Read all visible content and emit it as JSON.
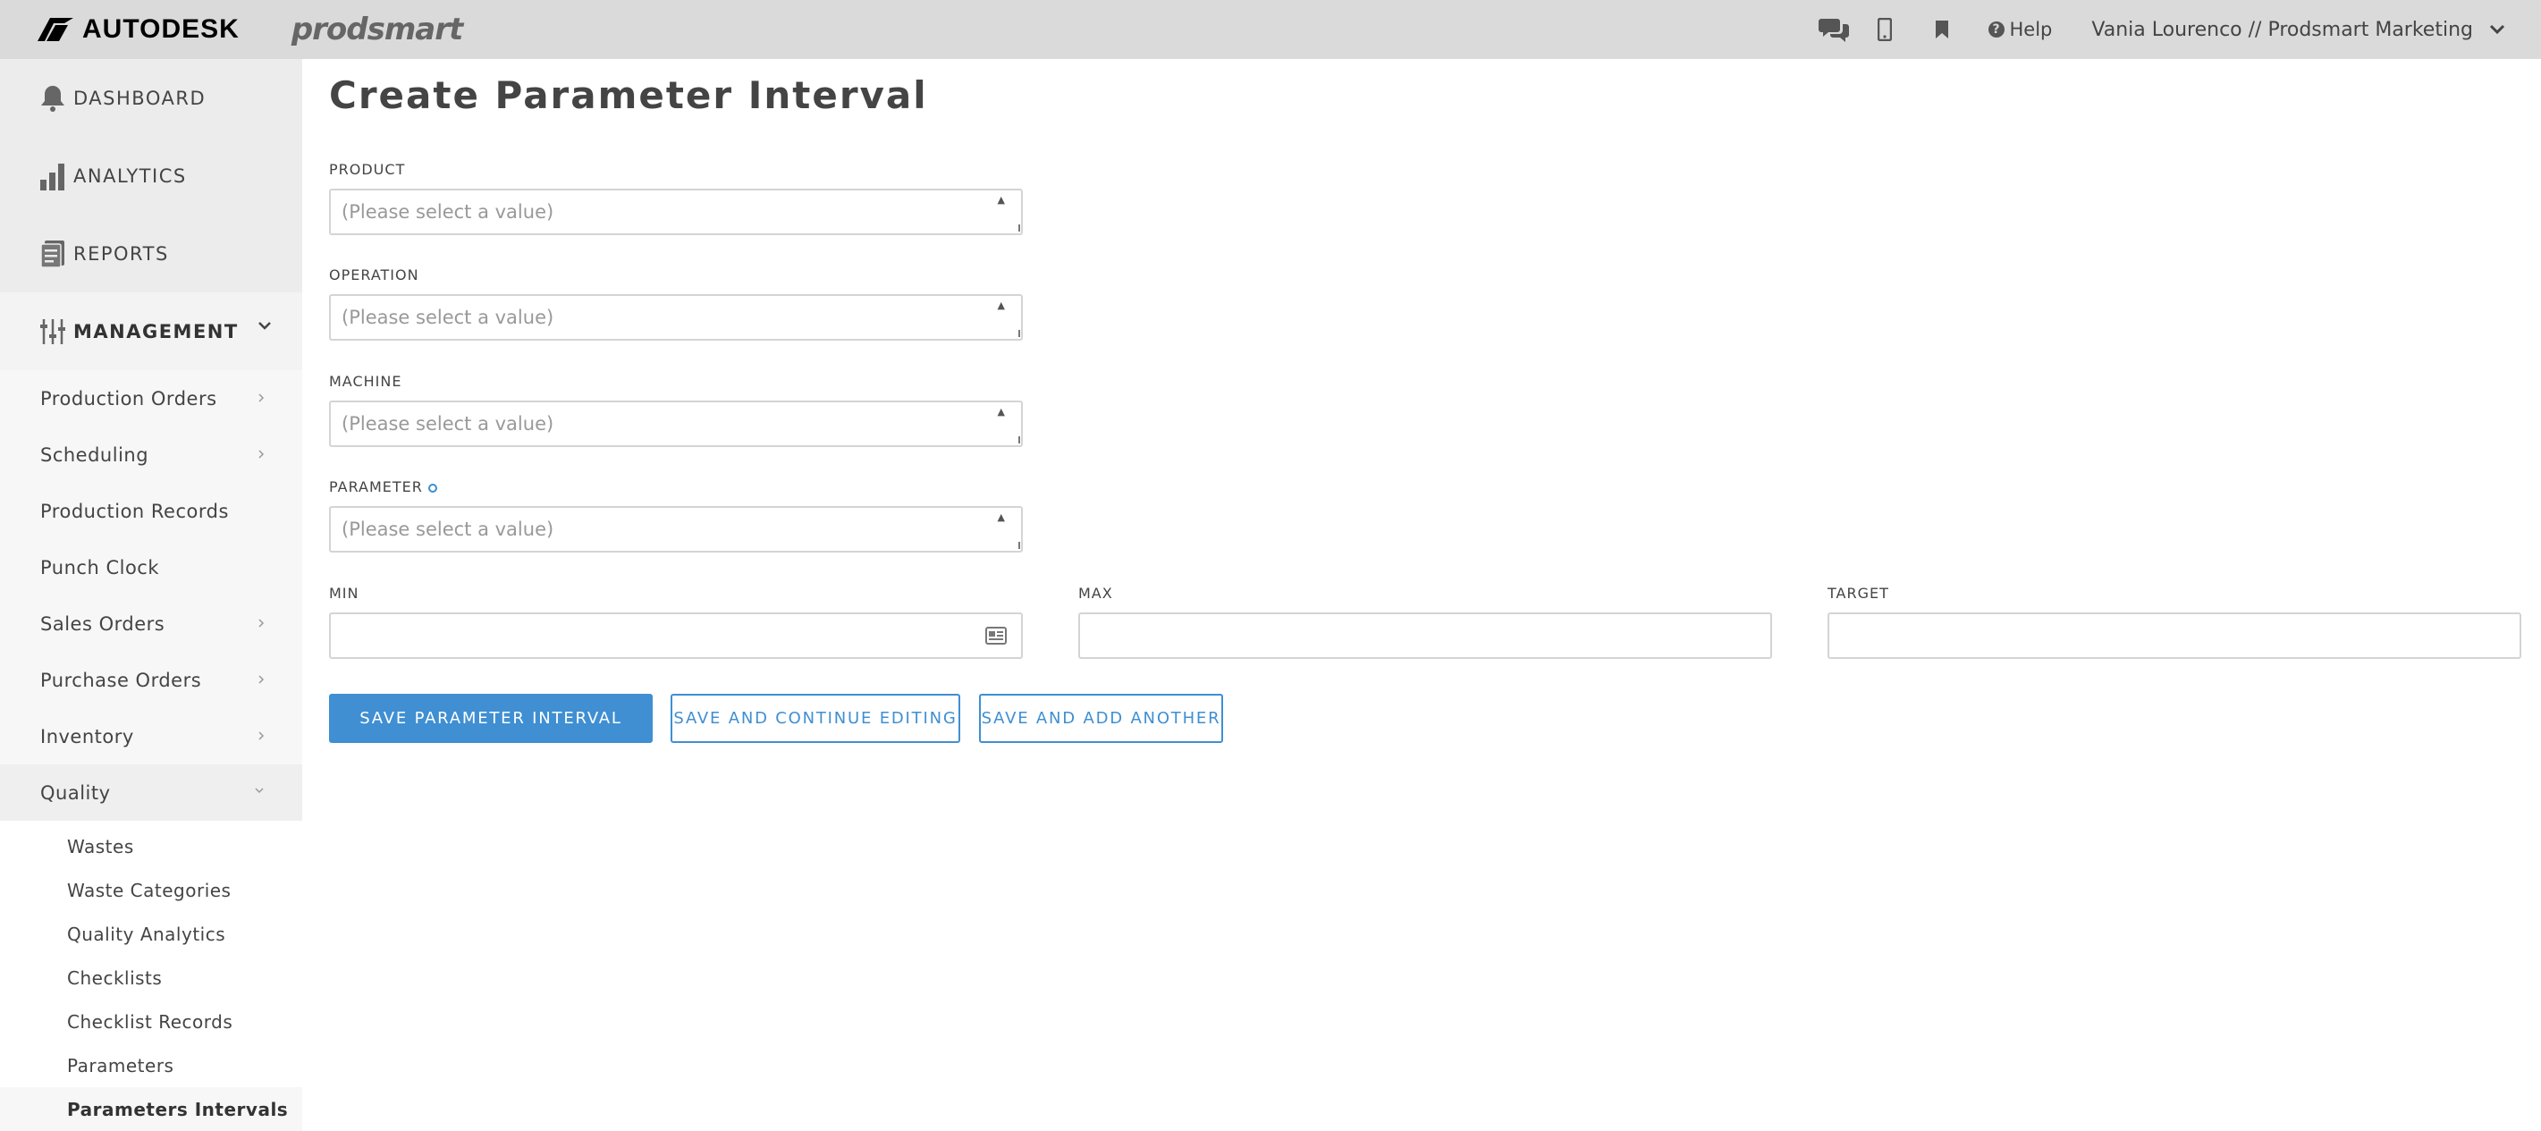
{
  "header": {
    "brand": "AUTODESK",
    "product": "prodsmart",
    "help_label": "Help",
    "user_label": "Vania Lourenco // Prodsmart Marketing"
  },
  "sidebar": {
    "main_items": [
      {
        "label": "DASHBOARD",
        "icon": "bell-icon"
      },
      {
        "label": "ANALYTICS",
        "icon": "bar-chart-icon"
      },
      {
        "label": "REPORTS",
        "icon": "reports-icon"
      },
      {
        "label": "MANAGEMENT",
        "icon": "sliders-icon"
      }
    ],
    "sub_items": [
      {
        "label": "Production Orders"
      },
      {
        "label": "Scheduling"
      },
      {
        "label": "Production Records"
      },
      {
        "label": "Punch Clock"
      },
      {
        "label": "Sales Orders"
      },
      {
        "label": "Purchase Orders"
      },
      {
        "label": "Inventory"
      },
      {
        "label": "Quality"
      }
    ],
    "quality_items": [
      {
        "label": "Wastes"
      },
      {
        "label": "Waste Categories"
      },
      {
        "label": "Quality Analytics"
      },
      {
        "label": "Checklists"
      },
      {
        "label": "Checklist Records"
      },
      {
        "label": "Parameters"
      },
      {
        "label": "Parameters Intervals"
      }
    ]
  },
  "main": {
    "title": "Create Parameter Interval",
    "fields": {
      "product": {
        "label": "PRODUCT",
        "placeholder": "(Please select a value)"
      },
      "operation": {
        "label": "OPERATION",
        "placeholder": "(Please select a value)"
      },
      "machine": {
        "label": "MACHINE",
        "placeholder": "(Please select a value)"
      },
      "parameter": {
        "label": "PARAMETER",
        "placeholder": "(Please select a value)"
      },
      "min": {
        "label": "MIN",
        "value": ""
      },
      "max": {
        "label": "MAX",
        "value": ""
      },
      "target": {
        "label": "TARGET",
        "value": ""
      }
    },
    "buttons": {
      "save": "SAVE PARAMETER INTERVAL",
      "save_continue": "SAVE AND CONTINUE EDITING",
      "save_add": "SAVE AND ADD ANOTHER"
    }
  },
  "colors": {
    "accent": "#3f8fd2",
    "topbar_bg": "#dadada",
    "sidebar_bg": "#f7f7f7"
  }
}
